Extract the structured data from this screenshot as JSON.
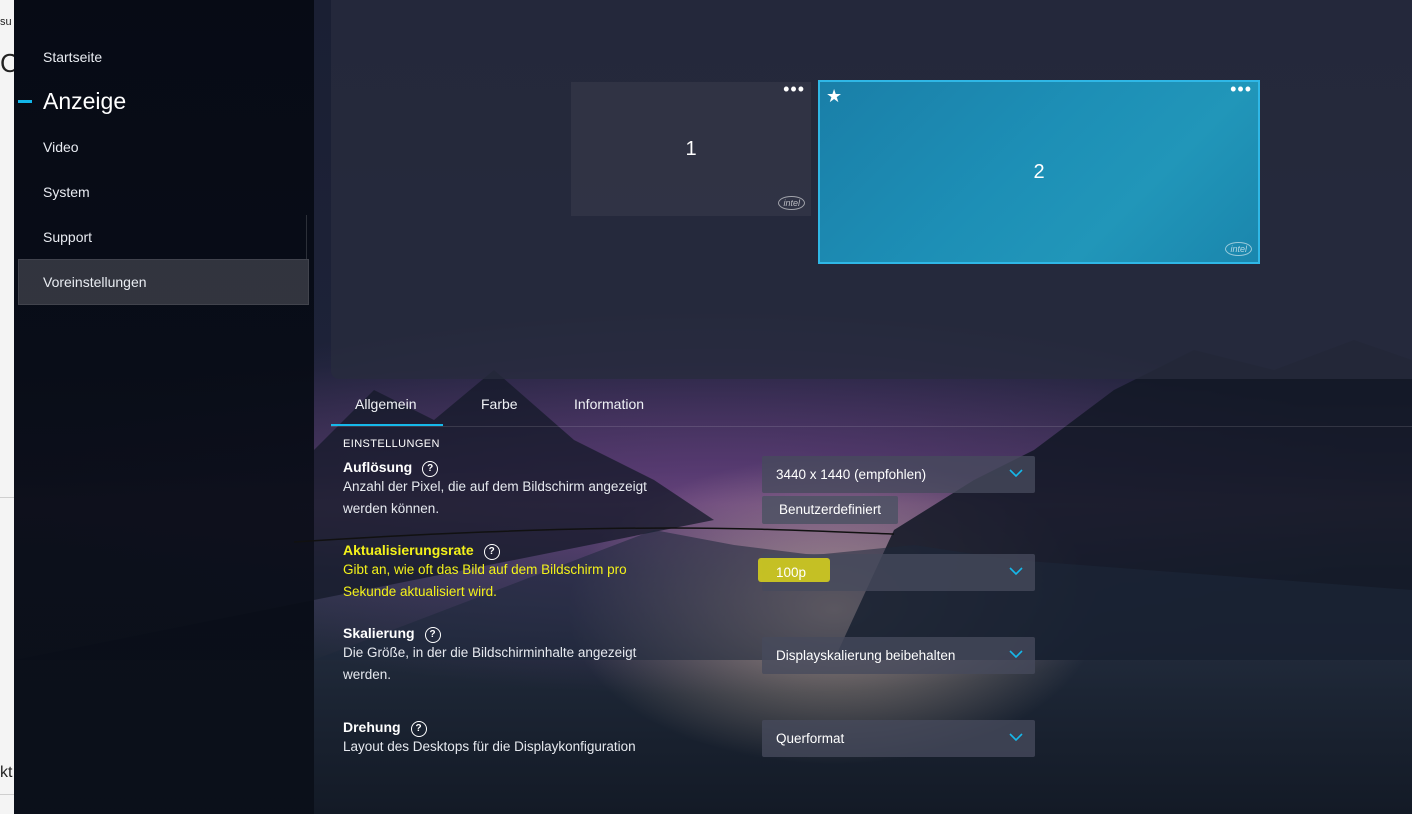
{
  "background_window": {
    "fragment_top": "su",
    "fragment_mid": "C",
    "fragment_bottom": "kt"
  },
  "sidebar": {
    "items": [
      {
        "label": "Startseite"
      },
      {
        "label": "Anzeige",
        "active": true
      },
      {
        "label": "Video"
      },
      {
        "label": "System"
      },
      {
        "label": "Support"
      },
      {
        "label": "Voreinstellungen",
        "highlighted": true
      }
    ]
  },
  "displays": [
    {
      "number": "1",
      "menu": "•••",
      "badge": "intel"
    },
    {
      "number": "2",
      "menu": "•••",
      "badge": "intel",
      "primary_icon": "★",
      "selected": true
    }
  ],
  "tabs": [
    {
      "label": "Allgemein",
      "active": true
    },
    {
      "label": "Farbe"
    },
    {
      "label": "Information"
    }
  ],
  "settings": {
    "section_title": "EINSTELLUNGEN",
    "help_glyph": "?",
    "resolution": {
      "title": "Auflösung",
      "description": "Anzahl der Pixel, die auf dem Bildschirm angezeigt werden können.",
      "value": "3440 x 1440 (empfohlen)",
      "custom_button": "Benutzerdefiniert"
    },
    "refresh_rate": {
      "title": "Aktualisierungsrate",
      "description": "Gibt an, wie oft das Bild auf dem Bildschirm pro Sekunde aktualisiert wird.",
      "value": "100p"
    },
    "scaling": {
      "title": "Skalierung",
      "description": "Die Größe, in der die Bildschirminhalte angezeigt werden.",
      "value": "Displayskalierung beibehalten"
    },
    "rotation": {
      "title": "Drehung",
      "description": "Layout des Desktops für die Displaykonfiguration",
      "value": "Querformat"
    }
  },
  "colors": {
    "accent": "#16b8ea",
    "annotation_yellow": "#f4f21a"
  }
}
